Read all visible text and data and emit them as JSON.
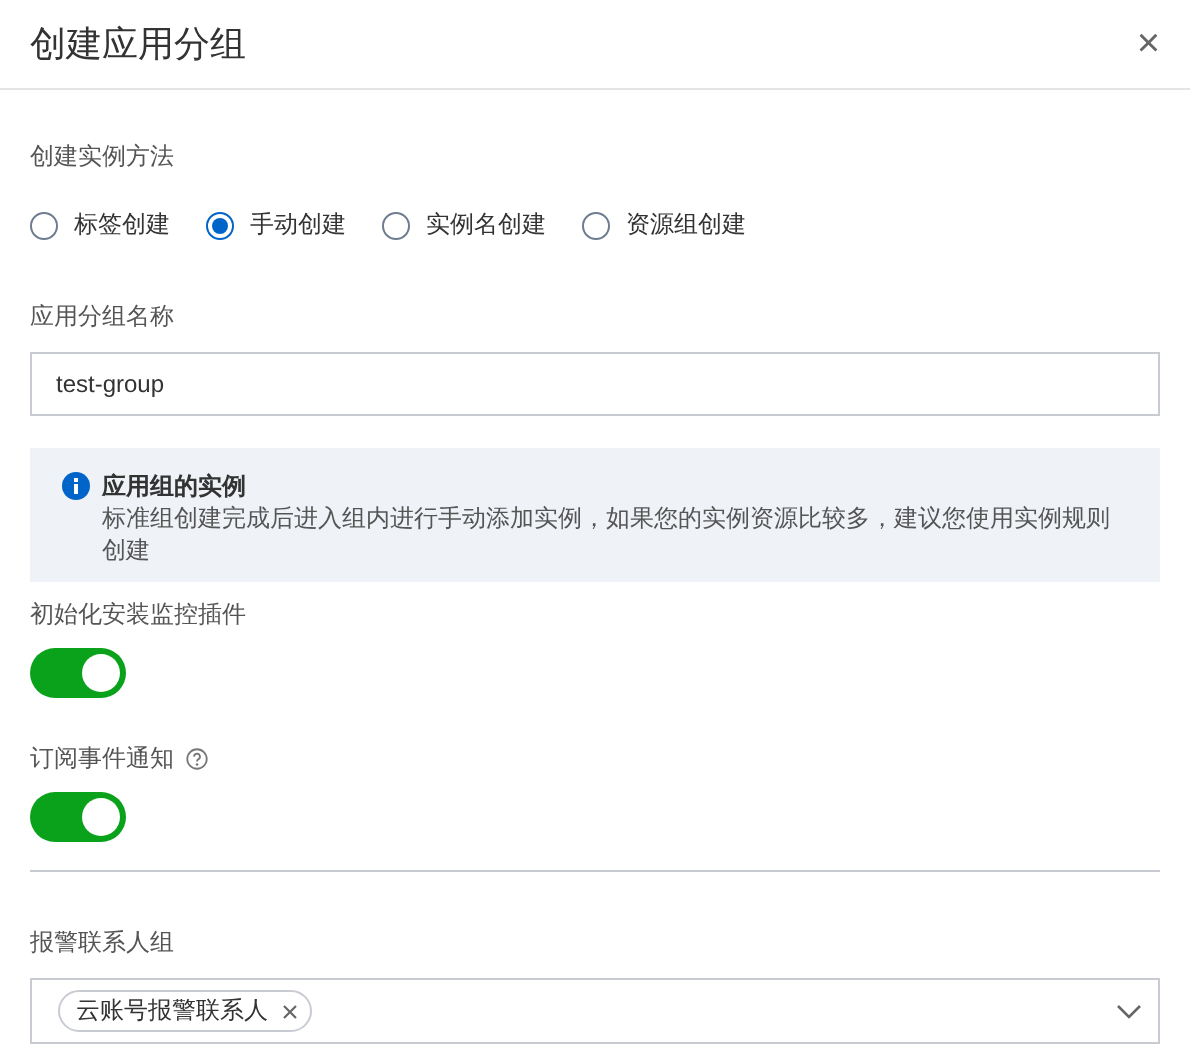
{
  "dialog": {
    "title": "创建应用分组",
    "close": "×"
  },
  "method": {
    "label": "创建实例方法",
    "options": [
      {
        "label": "标签创建",
        "selected": false
      },
      {
        "label": "手动创建",
        "selected": true
      },
      {
        "label": "实例名创建",
        "selected": false
      },
      {
        "label": "资源组创建",
        "selected": false
      }
    ]
  },
  "name_field": {
    "label": "应用分组名称",
    "value": "test-group"
  },
  "notice": {
    "title": "应用组的实例",
    "text": "标准组创建完成后进入组内进行手动添加实例，如果您的实例资源比较多，建议您使用实例规则创建"
  },
  "switches": [
    {
      "label": "初始化安装监控插件",
      "on": true,
      "help": false
    },
    {
      "label": "订阅事件通知",
      "on": true,
      "help": true
    }
  ],
  "contacts": {
    "label": "报警联系人组",
    "tags": [
      "云账号报警联系人"
    ]
  }
}
